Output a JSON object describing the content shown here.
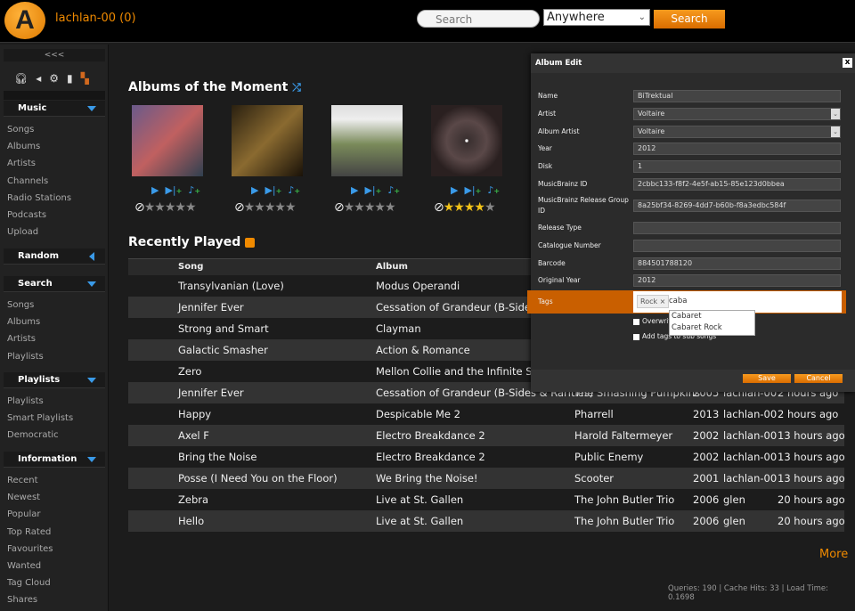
{
  "header": {
    "logo": "A",
    "user": "lachlan-00 (0)",
    "search_placeholder": "Search",
    "scope": "Anywhere",
    "search_button": "Search"
  },
  "sidebar": {
    "collapse": "<<<",
    "sections": [
      {
        "title": "Music",
        "items": [
          "Songs",
          "Albums",
          "Artists",
          "Channels",
          "Radio Stations",
          "Podcasts",
          "Upload"
        ]
      },
      {
        "title": "Random",
        "items": []
      },
      {
        "title": "Search",
        "items": [
          "Songs",
          "Albums",
          "Artists",
          "Playlists"
        ]
      },
      {
        "title": "Playlists",
        "items": [
          "Playlists",
          "Smart Playlists",
          "Democratic"
        ]
      },
      {
        "title": "Information",
        "items": [
          "Recent",
          "Newest",
          "Popular",
          "Top Rated",
          "Favourites",
          "Wanted",
          "Tag Cloud",
          "Shares"
        ]
      }
    ]
  },
  "albums_title": "Albums of the Moment",
  "album_ratings": [
    0,
    0,
    0,
    4
  ],
  "recent_title": "Recently Played",
  "table": {
    "headers": [
      "Song",
      "Album"
    ],
    "rows": [
      [
        "Transylvanian (Love)",
        "Modus Operandi",
        "",
        "",
        "",
        ""
      ],
      [
        "Jennifer Ever",
        "Cessation of Grandeur (B-Sides & R",
        "",
        "",
        "",
        ""
      ],
      [
        "Strong and Smart",
        "Clayman",
        "",
        "",
        "",
        ""
      ],
      [
        "Galactic Smasher",
        "Action & Romance",
        "",
        "",
        "",
        ""
      ],
      [
        "Zero",
        "Mellon Collie and the Infinite Sadne",
        "",
        "",
        "",
        ""
      ],
      [
        "Jennifer Ever",
        "Cessation of Grandeur (B-Sides & Rarities)",
        "The Smashing Pumpkins",
        "2005",
        "lachlan-00",
        "2 hours ago"
      ],
      [
        "Happy",
        "Despicable Me 2",
        "Pharrell",
        "2013",
        "lachlan-00",
        "2 hours ago"
      ],
      [
        "Axel F",
        "Electro Breakdance 2",
        "Harold Faltermeyer",
        "2002",
        "lachlan-00",
        "13 hours ago"
      ],
      [
        "Bring the Noise",
        "Electro Breakdance 2",
        "Public Enemy",
        "2002",
        "lachlan-00",
        "13 hours ago"
      ],
      [
        "Posse (I Need You on the Floor)",
        "We Bring the Noise!",
        "Scooter",
        "2001",
        "lachlan-00",
        "13 hours ago"
      ],
      [
        "Zebra",
        "Live at St. Gallen",
        "The John Butler Trio",
        "2006",
        "glen",
        "20 hours ago"
      ],
      [
        "Hello",
        "Live at St. Gallen",
        "The John Butler Trio",
        "2006",
        "glen",
        "20 hours ago"
      ]
    ]
  },
  "more": "More",
  "stats": "Queries: 190 | Cache Hits: 33 | Load Time: 0.1698",
  "dialog": {
    "title": "Album Edit",
    "close": "x",
    "fields": [
      {
        "label": "Name",
        "value": "BiTrektual"
      },
      {
        "label": "Artist",
        "value": "Voltaire",
        "select": true
      },
      {
        "label": "Album Artist",
        "value": "Voltaire",
        "select": true
      },
      {
        "label": "Year",
        "value": "2012"
      },
      {
        "label": "Disk",
        "value": "1"
      },
      {
        "label": "MusicBrainz ID",
        "value": "2cbbc133-f8f2-4e5f-ab15-85e123d0bbea"
      },
      {
        "label": "MusicBrainz Release Group ID",
        "value": "8a25bf34-8269-4dd7-b60b-f8a3edbc584f"
      },
      {
        "label": "Release Type",
        "value": ""
      },
      {
        "label": "Catalogue Number",
        "value": ""
      },
      {
        "label": "Barcode",
        "value": "884501788120"
      },
      {
        "label": "Original Year",
        "value": "2012"
      }
    ],
    "tags_label": "Tags",
    "tag_chip": "Rock ×",
    "tag_typed": "caba",
    "suggestions": [
      "Cabaret",
      "Cabaret Rock"
    ],
    "overwrite": "Overwrite",
    "add_sub": "Add tags to sub songs",
    "save": "Save",
    "cancel": "Cancel"
  }
}
